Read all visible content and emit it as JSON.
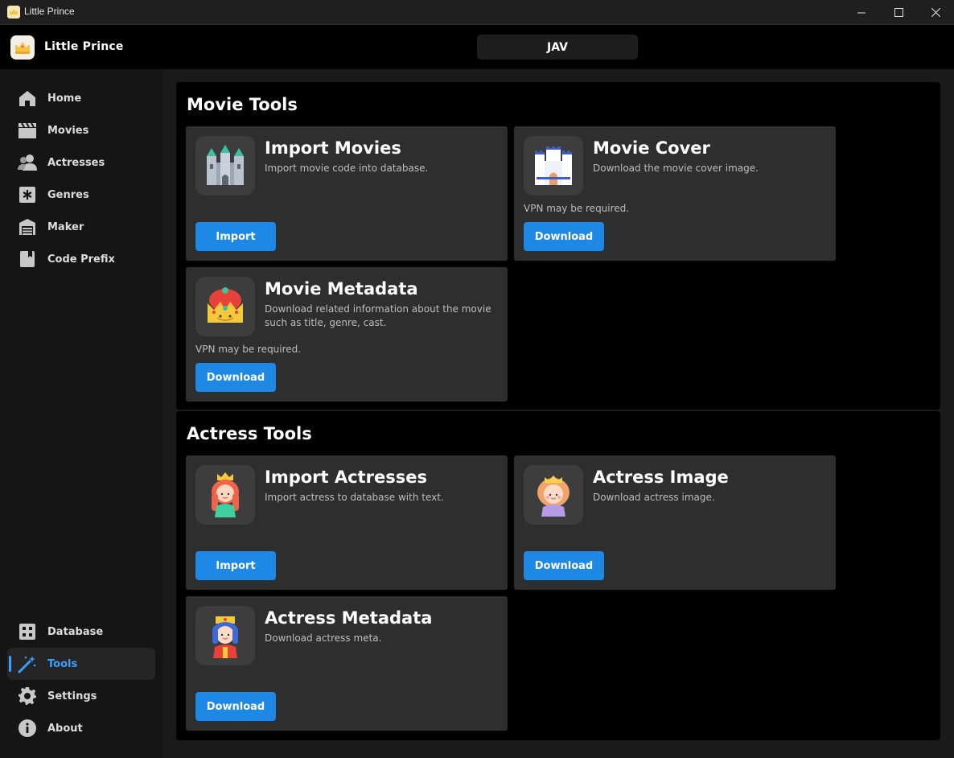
{
  "window": {
    "title": "Little Prince",
    "minimize_icon": "minimize-icon",
    "maximize_icon": "maximize-icon",
    "close_icon": "close-icon"
  },
  "header": {
    "app_name": "Little Prince",
    "mode": "JAV"
  },
  "sidebar": {
    "top_items": [
      {
        "label": "Home",
        "icon": "home-icon"
      },
      {
        "label": "Movies",
        "icon": "clapperboard-icon"
      },
      {
        "label": "Actresses",
        "icon": "people-icon"
      },
      {
        "label": "Genres",
        "icon": "asterisk-icon"
      },
      {
        "label": "Maker",
        "icon": "warehouse-icon"
      },
      {
        "label": "Code Prefix",
        "icon": "book-icon"
      }
    ],
    "bottom_items": [
      {
        "label": "Database",
        "icon": "grid-icon"
      },
      {
        "label": "Tools",
        "icon": "magic-wand-icon",
        "active": true
      },
      {
        "label": "Settings",
        "icon": "gear-icon"
      },
      {
        "label": "About",
        "icon": "info-icon"
      }
    ],
    "accent_color": "#3aa0ff"
  },
  "movie_tools": {
    "title": "Movie Tools",
    "cards": [
      {
        "title": "Import Movies",
        "description": "Import movie code into database.",
        "note": "",
        "button": "Import",
        "icon": "castle-icon"
      },
      {
        "title": "Movie Cover",
        "description": "Download the movie cover image.",
        "note": "VPN may be required.",
        "button": "Download",
        "icon": "white-castle-icon"
      },
      {
        "title": "Movie Metadata",
        "description": "Download related information about the movie such as title, genre, cast.",
        "note": "VPN may be required.",
        "button": "Download",
        "icon": "king-icon"
      }
    ]
  },
  "actress_tools": {
    "title": "Actress Tools",
    "cards": [
      {
        "title": "Import Actresses",
        "description": "Import actress to database with text.",
        "note": "",
        "button": "Import",
        "icon": "princess-icon"
      },
      {
        "title": "Actress Image",
        "description": "Download actress image.",
        "note": "",
        "button": "Download",
        "icon": "queen-icon"
      },
      {
        "title": "Actress Metadata",
        "description": "Download actress meta.",
        "note": "",
        "button": "Download",
        "icon": "prince-icon"
      }
    ]
  },
  "colors": {
    "button": "#1e88e5",
    "card_bg": "#2e2e2e"
  }
}
